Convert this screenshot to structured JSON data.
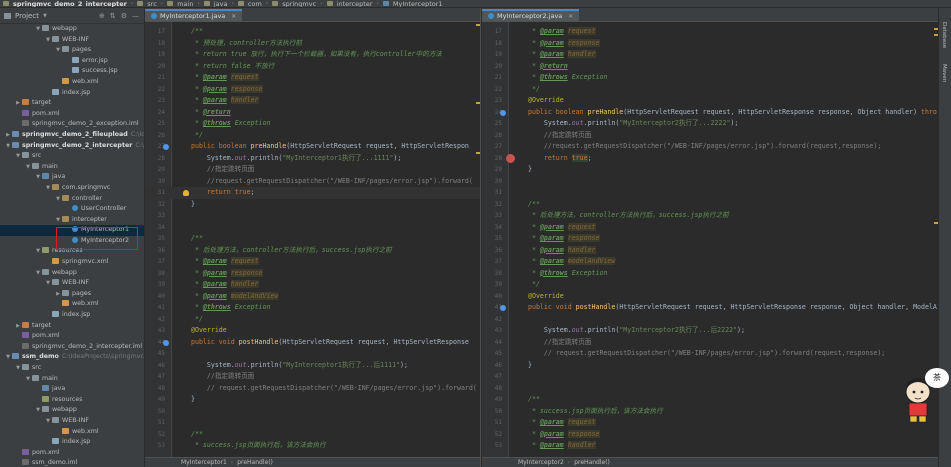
{
  "navbar": {
    "crumbs": [
      "springmvc_demo_2_intercepter",
      "src",
      "main",
      "java",
      "com",
      "springmvc",
      "intercepter",
      "MyInterceptor1"
    ]
  },
  "project": {
    "title": "Project",
    "tree": [
      {
        "name": "webapp",
        "indent": 3,
        "icon": "folder",
        "arrow": "down"
      },
      {
        "name": "WEB-INF",
        "indent": 4,
        "icon": "folder",
        "arrow": "down"
      },
      {
        "name": "pages",
        "indent": 5,
        "icon": "folder",
        "arrow": "down"
      },
      {
        "name": "error.jsp",
        "indent": 6,
        "icon": "jsp"
      },
      {
        "name": "success.jsp",
        "indent": 6,
        "icon": "jsp"
      },
      {
        "name": "web.xml",
        "indent": 5,
        "icon": "xml"
      },
      {
        "name": "index.jsp",
        "indent": 4,
        "icon": "jsp"
      },
      {
        "name": "target",
        "indent": 1,
        "icon": "folder-target",
        "arrow": "right"
      },
      {
        "name": "pom.xml",
        "indent": 1,
        "icon": "pom"
      },
      {
        "name": "springmvc_demo_2_exception.iml",
        "indent": 1,
        "icon": "iml"
      },
      {
        "name": "springmvc_demo_2_fileupload",
        "indent": 0,
        "icon": "module",
        "arrow": "right",
        "bold": true,
        "path": "C:\\IdeaProjects\\..."
      },
      {
        "name": "springmvc_demo_2_intercepter",
        "indent": 0,
        "icon": "module",
        "arrow": "down",
        "bold": true,
        "path": "C:\\IdeaProjects\\springmvc\\springmvc_demo_2_intercepter"
      },
      {
        "name": "src",
        "indent": 1,
        "icon": "folder",
        "arrow": "down"
      },
      {
        "name": "main",
        "indent": 2,
        "icon": "folder",
        "arrow": "down"
      },
      {
        "name": "java",
        "indent": 3,
        "icon": "folder-src",
        "arrow": "down"
      },
      {
        "name": "com.springmvc",
        "indent": 4,
        "icon": "pkg",
        "arrow": "down"
      },
      {
        "name": "controller",
        "indent": 5,
        "icon": "pkg",
        "arrow": "down"
      },
      {
        "name": "UserController",
        "indent": 6,
        "icon": "class"
      },
      {
        "name": "intercepter",
        "indent": 5,
        "icon": "pkg",
        "arrow": "down"
      },
      {
        "name": "MyInterceptor1",
        "indent": 6,
        "icon": "class",
        "selected": true
      },
      {
        "name": "MyInterceptor2",
        "indent": 6,
        "icon": "class"
      },
      {
        "name": "resources",
        "indent": 3,
        "icon": "folder-res",
        "arrow": "down"
      },
      {
        "name": "springmvc.xml",
        "indent": 4,
        "icon": "xml"
      },
      {
        "name": "webapp",
        "indent": 3,
        "icon": "folder",
        "arrow": "down"
      },
      {
        "name": "WEB-INF",
        "indent": 4,
        "icon": "folder",
        "arrow": "down"
      },
      {
        "name": "pages",
        "indent": 5,
        "icon": "folder",
        "arrow": "right"
      },
      {
        "name": "web.xml",
        "indent": 5,
        "icon": "xml"
      },
      {
        "name": "index.jsp",
        "indent": 4,
        "icon": "jsp"
      },
      {
        "name": "target",
        "indent": 1,
        "icon": "folder-target",
        "arrow": "right"
      },
      {
        "name": "pom.xml",
        "indent": 1,
        "icon": "pom"
      },
      {
        "name": "springmvc_demo_2_intercepter.iml",
        "indent": 1,
        "icon": "iml"
      },
      {
        "name": "ssm_demo",
        "indent": 0,
        "icon": "module",
        "arrow": "down",
        "bold": true,
        "path": "C:\\IdeaProjects\\springmvc\\ssm_demo"
      },
      {
        "name": "src",
        "indent": 1,
        "icon": "folder",
        "arrow": "down"
      },
      {
        "name": "main",
        "indent": 2,
        "icon": "folder",
        "arrow": "down"
      },
      {
        "name": "java",
        "indent": 3,
        "icon": "folder-src"
      },
      {
        "name": "resources",
        "indent": 3,
        "icon": "folder-res"
      },
      {
        "name": "webapp",
        "indent": 3,
        "icon": "folder",
        "arrow": "down"
      },
      {
        "name": "WEB-INF",
        "indent": 4,
        "icon": "folder",
        "arrow": "down"
      },
      {
        "name": "web.xml",
        "indent": 5,
        "icon": "xml"
      },
      {
        "name": "index.jsp",
        "indent": 4,
        "icon": "jsp"
      },
      {
        "name": "pom.xml",
        "indent": 1,
        "icon": "pom"
      },
      {
        "name": "ssm_demo.iml",
        "indent": 1,
        "icon": "iml"
      }
    ]
  },
  "left_editor": {
    "tab": "MyInterceptor1.java",
    "breadcrumb": [
      "MyInterceptor1",
      "preHandle()"
    ],
    "lines": [
      {
        "n": "17",
        "html": "<span class=\"cm\">/**</span>"
      },
      {
        "n": "18",
        "html": "<span class=\"cm\"> * 预处理，controller方法执行前</span>"
      },
      {
        "n": "19",
        "html": "<span class=\"cm\"> * return true 放行，执行下一个拦截器，如果没有，执行controller中的方法</span>"
      },
      {
        "n": "20",
        "html": "<span class=\"cm\"> * return false 不放行</span>"
      },
      {
        "n": "21",
        "html": "<span class=\"cm\"> * </span><span class=\"ct\">@param</span> <span class=\"cp\">request</span>"
      },
      {
        "n": "22",
        "html": "<span class=\"cm\"> * </span><span class=\"ct\">@param</span> <span class=\"cp\">response</span>"
      },
      {
        "n": "23",
        "html": "<span class=\"cm\"> * </span><span class=\"ct\">@param</span> <span class=\"cp\">handler</span>"
      },
      {
        "n": "24",
        "html": "<span class=\"cm\"> * </span><span class=\"ct\">@return</span>"
      },
      {
        "n": "25",
        "html": "<span class=\"cm\"> * </span><span class=\"ct\">@throws</span><span class=\"cm\"> Exception</span>"
      },
      {
        "n": "26",
        "html": "<span class=\"cm\"> */</span>"
      },
      {
        "n": "27",
        "html": "<span class=\"kw\">public boolean </span><span class=\"fn\">preHandle</span><span class=\"pl\">(HttpServletRequest request, HttpServletRespon</span>",
        "mark": "impl"
      },
      {
        "n": "28",
        "html": "<span class=\"pl\">    System.</span><span class=\"sf\">out</span><span class=\"pl\">.println(</span><span class=\"st\">\"MyInterceptor1执行了...1111\"</span><span class=\"pl\">);</span>"
      },
      {
        "n": "29",
        "html": "<span class=\"lc\">    //指定跳转页面</span>"
      },
      {
        "n": "30",
        "html": "<span class=\"lc\">    //request.getRequestDispatcher(\"/WEB-INF/pages/error.jsp\").forward(</span>"
      },
      {
        "n": "31",
        "html": "<span class=\"kw\">    return true</span><span class=\"pl\">;</span>",
        "mark": "bulb",
        "current": true
      },
      {
        "n": "32",
        "html": "<span class=\"pl\">}</span>"
      },
      {
        "n": "33",
        "html": ""
      },
      {
        "n": "34",
        "html": ""
      },
      {
        "n": "35",
        "html": "<span class=\"cm\">/**</span>"
      },
      {
        "n": "36",
        "html": "<span class=\"cm\"> * 后处理方法，controller方法执行后，success.jsp执行之前</span>"
      },
      {
        "n": "37",
        "html": "<span class=\"cm\"> * </span><span class=\"ct\">@param</span> <span class=\"cp\">request</span>"
      },
      {
        "n": "38",
        "html": "<span class=\"cm\"> * </span><span class=\"ct\">@param</span> <span class=\"cp\">response</span>"
      },
      {
        "n": "39",
        "html": "<span class=\"cm\"> * </span><span class=\"ct\">@param</span> <span class=\"cp\">handler</span>"
      },
      {
        "n": "40",
        "html": "<span class=\"cm\"> * </span><span class=\"ct\">@param</span> <span class=\"cp\">modelAndView</span>"
      },
      {
        "n": "41",
        "html": "<span class=\"cm\"> * </span><span class=\"ct\">@throws</span><span class=\"cm\"> Exception</span>"
      },
      {
        "n": "42",
        "html": "<span class=\"cm\"> */</span>"
      },
      {
        "n": "43",
        "html": "<span class=\"an\">@Override</span>"
      },
      {
        "n": "44",
        "html": "<span class=\"kw\">public void </span><span class=\"fn\">postHandle</span><span class=\"pl\">(HttpServletRequest request, HttpServletResponse</span>",
        "mark": "impl"
      },
      {
        "n": "45",
        "html": ""
      },
      {
        "n": "46",
        "html": "<span class=\"pl\">    System.</span><span class=\"sf\">out</span><span class=\"pl\">.println(</span><span class=\"st\">\"MyInterceptor1执行了...后1111\"</span><span class=\"pl\">);</span>"
      },
      {
        "n": "47",
        "html": "<span class=\"lc\">    //指定跳转页面</span>"
      },
      {
        "n": "48",
        "html": "<span class=\"lc\">    // request.getRequestDispatcher(\"/WEB-INF/pages/error.jsp\").forward(</span>"
      },
      {
        "n": "49",
        "html": "<span class=\"pl\">}</span>"
      },
      {
        "n": "50",
        "html": ""
      },
      {
        "n": "51",
        "html": ""
      },
      {
        "n": "52",
        "html": "<span class=\"cm\">/**</span>"
      },
      {
        "n": "53",
        "html": "<span class=\"cm\"> * success.jsp页面执行后，该方法会执行</span>"
      }
    ]
  },
  "right_editor": {
    "tab": "MyInterceptor2.java",
    "breadcrumb": [
      "MyInterceptor2",
      "preHandle()"
    ],
    "lines": [
      {
        "n": "17",
        "html": "<span class=\"cm\"> * </span><span class=\"ct\">@param</span> <span class=\"cp\">request</span>"
      },
      {
        "n": "18",
        "html": "<span class=\"cm\"> * </span><span class=\"ct\">@param</span> <span class=\"cp\">response</span>"
      },
      {
        "n": "19",
        "html": "<span class=\"cm\"> * </span><span class=\"ct\">@param</span> <span class=\"cp\">handler</span>"
      },
      {
        "n": "20",
        "html": "<span class=\"cm\"> * </span><span class=\"ct\">@return</span>"
      },
      {
        "n": "21",
        "html": "<span class=\"cm\"> * </span><span class=\"ct\">@throws</span><span class=\"cm\"> Exception</span>"
      },
      {
        "n": "22",
        "html": "<span class=\"cm\"> */</span>"
      },
      {
        "n": "23",
        "html": "<span class=\"an\">@Override</span>"
      },
      {
        "n": "24",
        "html": "<span class=\"kw\">public boolean </span><span class=\"fn\">preHandle</span><span class=\"pl\">(HttpServletRequest request, HttpServletResponse response, Object handler) </span><span class=\"kw\">thro</span>",
        "mark": "impl"
      },
      {
        "n": "25",
        "html": "<span class=\"pl\">    System.</span><span class=\"sf\">out</span><span class=\"pl\">.println(</span><span class=\"st\">\"MyInterceptor2执行了...2222\"</span><span class=\"pl\">);</span>"
      },
      {
        "n": "26",
        "html": "<span class=\"lc\">    //指定跳转页面</span>"
      },
      {
        "n": "27",
        "html": "<span class=\"lc\">    //request.getRequestDispatcher(\"/WEB-INF/pages/error.jsp\").forward(request,response);</span>"
      },
      {
        "n": "28",
        "html": "<span class=\"kw\">    return </span><span class=\"kw hl\">true</span><span class=\"pl\">;</span>",
        "mark": "bp"
      },
      {
        "n": "29",
        "html": "<span class=\"pl\">}</span>"
      },
      {
        "n": "30",
        "html": ""
      },
      {
        "n": "31",
        "html": ""
      },
      {
        "n": "32",
        "html": "<span class=\"cm\">/**</span>"
      },
      {
        "n": "33",
        "html": "<span class=\"cm\"> * 后处理方法，controller方法执行后，success.jsp执行之前</span>"
      },
      {
        "n": "34",
        "html": "<span class=\"cm\"> * </span><span class=\"ct\">@param</span> <span class=\"cp\">request</span>"
      },
      {
        "n": "35",
        "html": "<span class=\"cm\"> * </span><span class=\"ct\">@param</span> <span class=\"cp\">response</span>"
      },
      {
        "n": "36",
        "html": "<span class=\"cm\"> * </span><span class=\"ct\">@param</span> <span class=\"cp\">handler</span>"
      },
      {
        "n": "37",
        "html": "<span class=\"cm\"> * </span><span class=\"ct\">@param</span> <span class=\"cp\">modelAndView</span>"
      },
      {
        "n": "38",
        "html": "<span class=\"cm\"> * </span><span class=\"ct\">@throws</span><span class=\"cm\"> Exception</span>"
      },
      {
        "n": "39",
        "html": "<span class=\"cm\"> */</span>"
      },
      {
        "n": "40",
        "html": "<span class=\"an\">@Override</span>"
      },
      {
        "n": "41",
        "html": "<span class=\"kw\">public void </span><span class=\"fn\">postHandle</span><span class=\"pl\">(HttpServletRequest request, HttpServletResponse response, Object handler, ModelA</span>",
        "mark": "impl"
      },
      {
        "n": "42",
        "html": ""
      },
      {
        "n": "43",
        "html": "<span class=\"pl\">    System.</span><span class=\"sf\">out</span><span class=\"pl\">.println(</span><span class=\"st\">\"MyInterceptor2执行了...后2222\"</span><span class=\"pl\">);</span>"
      },
      {
        "n": "44",
        "html": "<span class=\"lc\">    //指定跳转页面</span>"
      },
      {
        "n": "45",
        "html": "<span class=\"lc\">    // request.getRequestDispatcher(\"/WEB-INF/pages/error.jsp\").forward(request,response);</span>"
      },
      {
        "n": "46",
        "html": "<span class=\"pl\">}</span>"
      },
      {
        "n": "47",
        "html": ""
      },
      {
        "n": "48",
        "html": ""
      },
      {
        "n": "49",
        "html": "<span class=\"cm\">/**</span>"
      },
      {
        "n": "50",
        "html": "<span class=\"cm\"> * success.jsp页面执行后，该方法会执行</span>"
      },
      {
        "n": "51",
        "html": "<span class=\"cm\"> * </span><span class=\"ct\">@param</span> <span class=\"cp\">request</span>"
      },
      {
        "n": "52",
        "html": "<span class=\"cm\"> * </span><span class=\"ct\">@param</span> <span class=\"cp\">response</span>"
      },
      {
        "n": "53",
        "html": "<span class=\"cm\"> * </span><span class=\"ct\">@param</span> <span class=\"cp\">handler</span>"
      }
    ]
  },
  "toolstrip": {
    "labels": [
      "Database",
      "Maven"
    ]
  },
  "mascot": {
    "bubble_text": "茶"
  }
}
